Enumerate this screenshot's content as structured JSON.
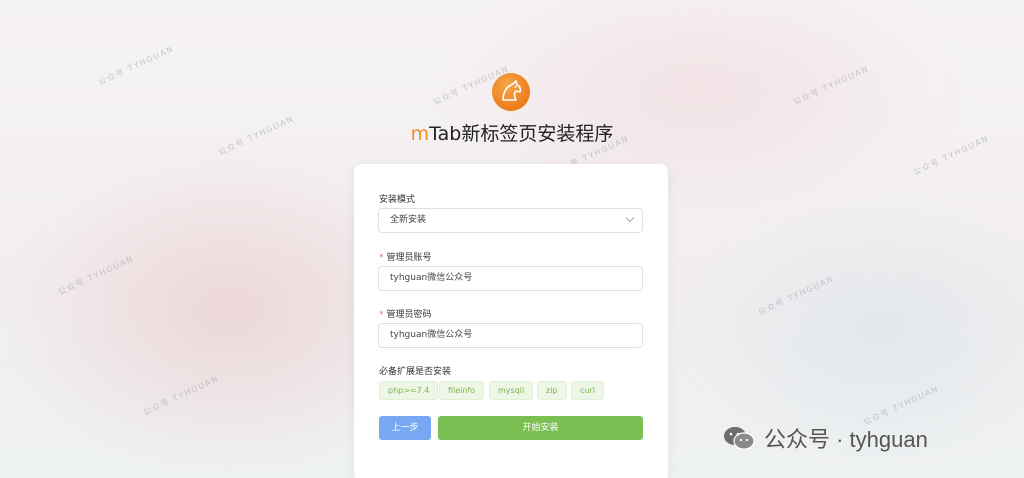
{
  "app": {
    "title_prefix": "m",
    "title_rest": "Tab新标签页安装程序"
  },
  "form": {
    "install_mode": {
      "label": "安装模式",
      "value": "全新安装"
    },
    "admin_account": {
      "required_mark": "*",
      "label": "管理员账号",
      "value": "tyhguan微信公众号"
    },
    "admin_password": {
      "required_mark": "*",
      "label": "管理员密码",
      "value": "tyhguan微信公众号"
    },
    "extensions": {
      "label": "必备扩展是否安装",
      "items": [
        "php>=7.4",
        "fileinfo",
        "mysqli",
        "zip",
        "curl"
      ]
    },
    "buttons": {
      "prev": "上一步",
      "start": "开始安装"
    }
  },
  "watermark": {
    "text": "公众号 TYHGUAN",
    "brand_text": "公众号 · tyhguan"
  },
  "colors": {
    "accent_orange": "#f08a24",
    "prev_button": "#79a8f2",
    "start_button": "#7cbf53",
    "tag_text": "#79b34a"
  }
}
